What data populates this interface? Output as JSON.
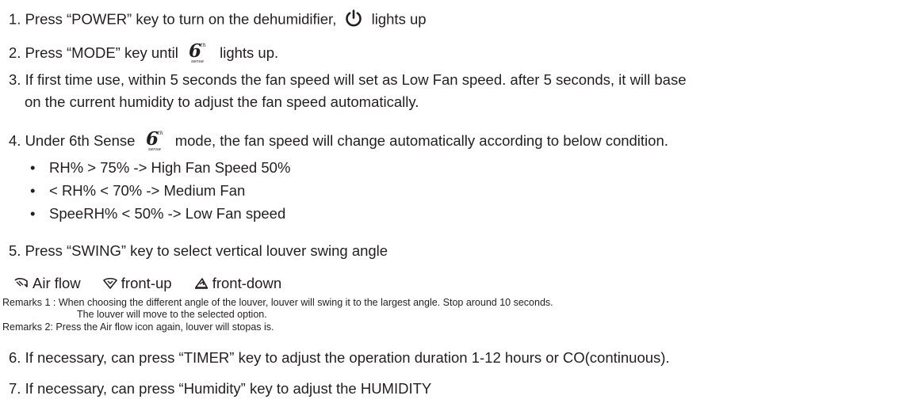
{
  "steps": {
    "s1_pre": "1. Press “POWER” key to turn on the dehumidifier,",
    "s1_post": "lights up",
    "s2_pre": "2. Press “MODE” key until",
    "s2_post": "lights up.",
    "s3_line1": "3. If first time use, within 5 seconds the fan speed will set as Low Fan speed. after 5 seconds, it will base",
    "s3_line2": "on the current humidity to adjust the fan speed automatically.",
    "s4_pre": "4. Under 6th Sense",
    "s4_post": "mode, the fan speed will change automatically according to below condition.",
    "bullets": [
      "RH% > 75% -> High Fan Speed 50%",
      "< RH% < 70% -> Medium Fan",
      "SpeeRH% < 50% -> Low Fan speed"
    ],
    "bullet_symbol": "•",
    "s5": "5. Press “SWING” key to select vertical louver swing angle",
    "swing_options": [
      "Air flow",
      "front-up",
      "front-down"
    ],
    "remark1_line1": "Remarks 1 : When choosing the different angle of the louver, louver will swing it to the largest angle. Stop around 10 seconds.",
    "remark1_line2": "The louver will move to the selected option.",
    "remark2": "Remarks 2: Press the Air flow icon again, louver will stopas is.",
    "s6": "6. If necessary, can press “TIMER” key to adjust the operation duration 1-12 hours or CO(continuous).",
    "s7": "7. If necessary, can press “Humidity” key to adjust the HUMIDITY"
  },
  "sense_icon": {
    "digit": "6",
    "sup": "th",
    "sub": "sense"
  },
  "icons": {
    "power": "power-icon",
    "sense": "sixth-sense-icon",
    "swing_airflow": "air-flow-swing-icon",
    "swing_front_up": "front-up-swing-icon",
    "swing_front_down": "front-down-swing-icon"
  }
}
